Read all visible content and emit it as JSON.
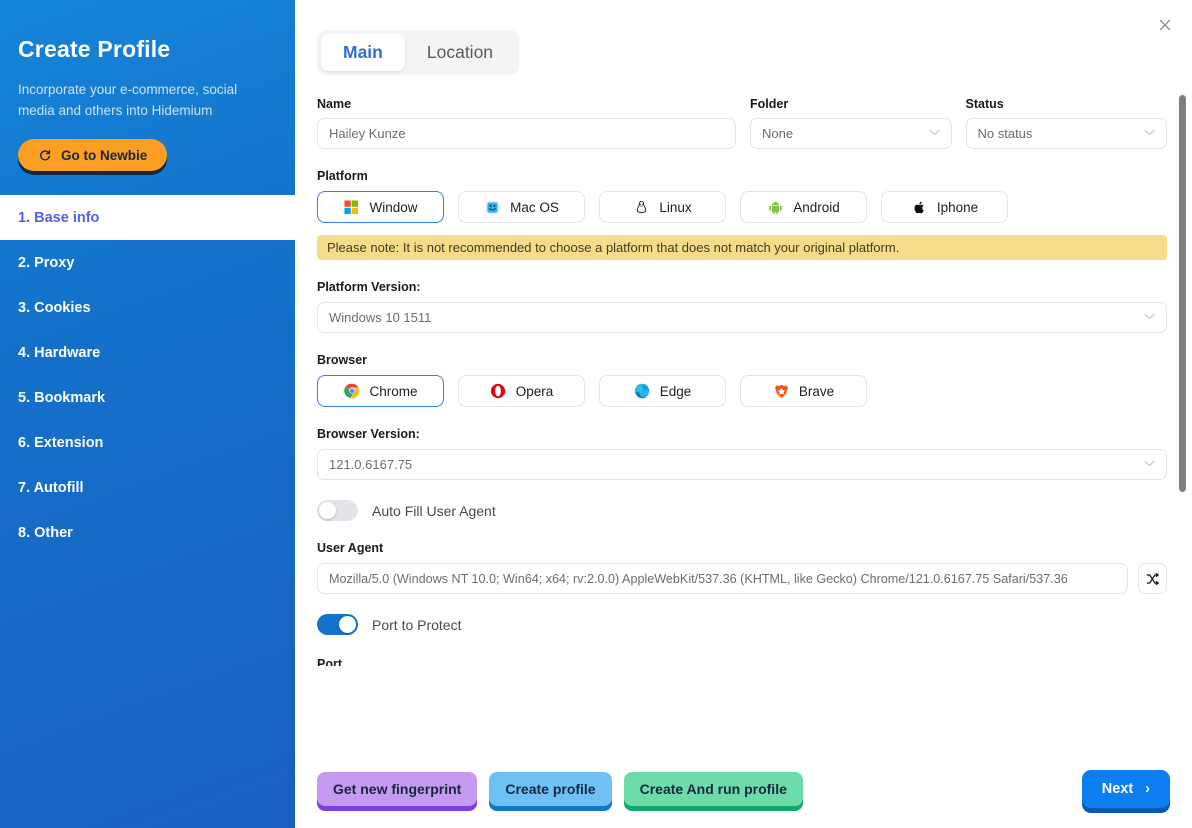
{
  "sidebar": {
    "title": "Create Profile",
    "subtitle": "Incorporate your e-commerce, social media and others into Hidemium",
    "newbie_button": "Go to Newbie",
    "items": [
      {
        "label": "1. Base info",
        "active": true
      },
      {
        "label": "2. Proxy",
        "active": false
      },
      {
        "label": "3. Cookies",
        "active": false
      },
      {
        "label": "4. Hardware",
        "active": false
      },
      {
        "label": "5. Bookmark",
        "active": false
      },
      {
        "label": "6. Extension",
        "active": false
      },
      {
        "label": "7. Autofill",
        "active": false
      },
      {
        "label": "8. Other",
        "active": false
      }
    ]
  },
  "header": {
    "close_label": "✕",
    "tabs": [
      {
        "label": "Main",
        "active": true
      },
      {
        "label": "Location",
        "active": false
      }
    ]
  },
  "form": {
    "name": {
      "label": "Name",
      "value": "Hailey Kunze"
    },
    "folder": {
      "label": "Folder",
      "value": "None"
    },
    "status": {
      "label": "Status",
      "value": "No status"
    },
    "platform": {
      "label": "Platform",
      "options": [
        {
          "label": "Window",
          "icon": "windows-icon",
          "selected": true
        },
        {
          "label": "Mac OS",
          "icon": "macos-icon",
          "selected": false
        },
        {
          "label": "Linux",
          "icon": "linux-icon",
          "selected": false
        },
        {
          "label": "Android",
          "icon": "android-icon",
          "selected": false
        },
        {
          "label": "Iphone",
          "icon": "apple-icon",
          "selected": false
        }
      ]
    },
    "note": "Please note: It is not recommended to choose a platform that does not match your original platform.",
    "platform_version": {
      "label": "Platform Version:",
      "value": "Windows 10 1511"
    },
    "browser": {
      "label": "Browser",
      "options": [
        {
          "label": "Chrome",
          "icon": "chrome-icon",
          "selected": true
        },
        {
          "label": "Opera",
          "icon": "opera-icon",
          "selected": false
        },
        {
          "label": "Edge",
          "icon": "edge-icon",
          "selected": false
        },
        {
          "label": "Brave",
          "icon": "brave-icon",
          "selected": false
        }
      ]
    },
    "browser_version": {
      "label": "Browser Version:",
      "value": "121.0.6167.75"
    },
    "auto_fill_user_agent": {
      "label": "Auto Fill User Agent",
      "on": false
    },
    "user_agent": {
      "label": "User Agent",
      "value": "Mozilla/5.0 (Windows NT 10.0; Win64; x64; rv:2.0.0) AppleWebKit/537.36 (KHTML, like Gecko) Chrome/121.0.6167.75 Safari/537.36",
      "shuffle_icon": "shuffle-icon"
    },
    "port_to_protect": {
      "label": "Port to Protect",
      "on": true
    },
    "port_label_cut": "Port"
  },
  "footer": {
    "get_new_fingerprint": "Get new fingerprint",
    "create_profile": "Create profile",
    "create_and_run_profile": "Create And run profile",
    "next": "Next",
    "next_chevron": "›"
  },
  "colors": {
    "sidebar_blue": "#1472cb",
    "accent_blue": "#2f80ed",
    "newbie_orange": "#fb9f23",
    "note_yellow": "#f7dd8a",
    "active_item_text": "#4f63e8",
    "fingerprint_purple": "#c49bf0",
    "create_blue": "#6fc0f5",
    "create_run_green": "#6ddcaa",
    "next_blue": "#0d7ef0"
  }
}
